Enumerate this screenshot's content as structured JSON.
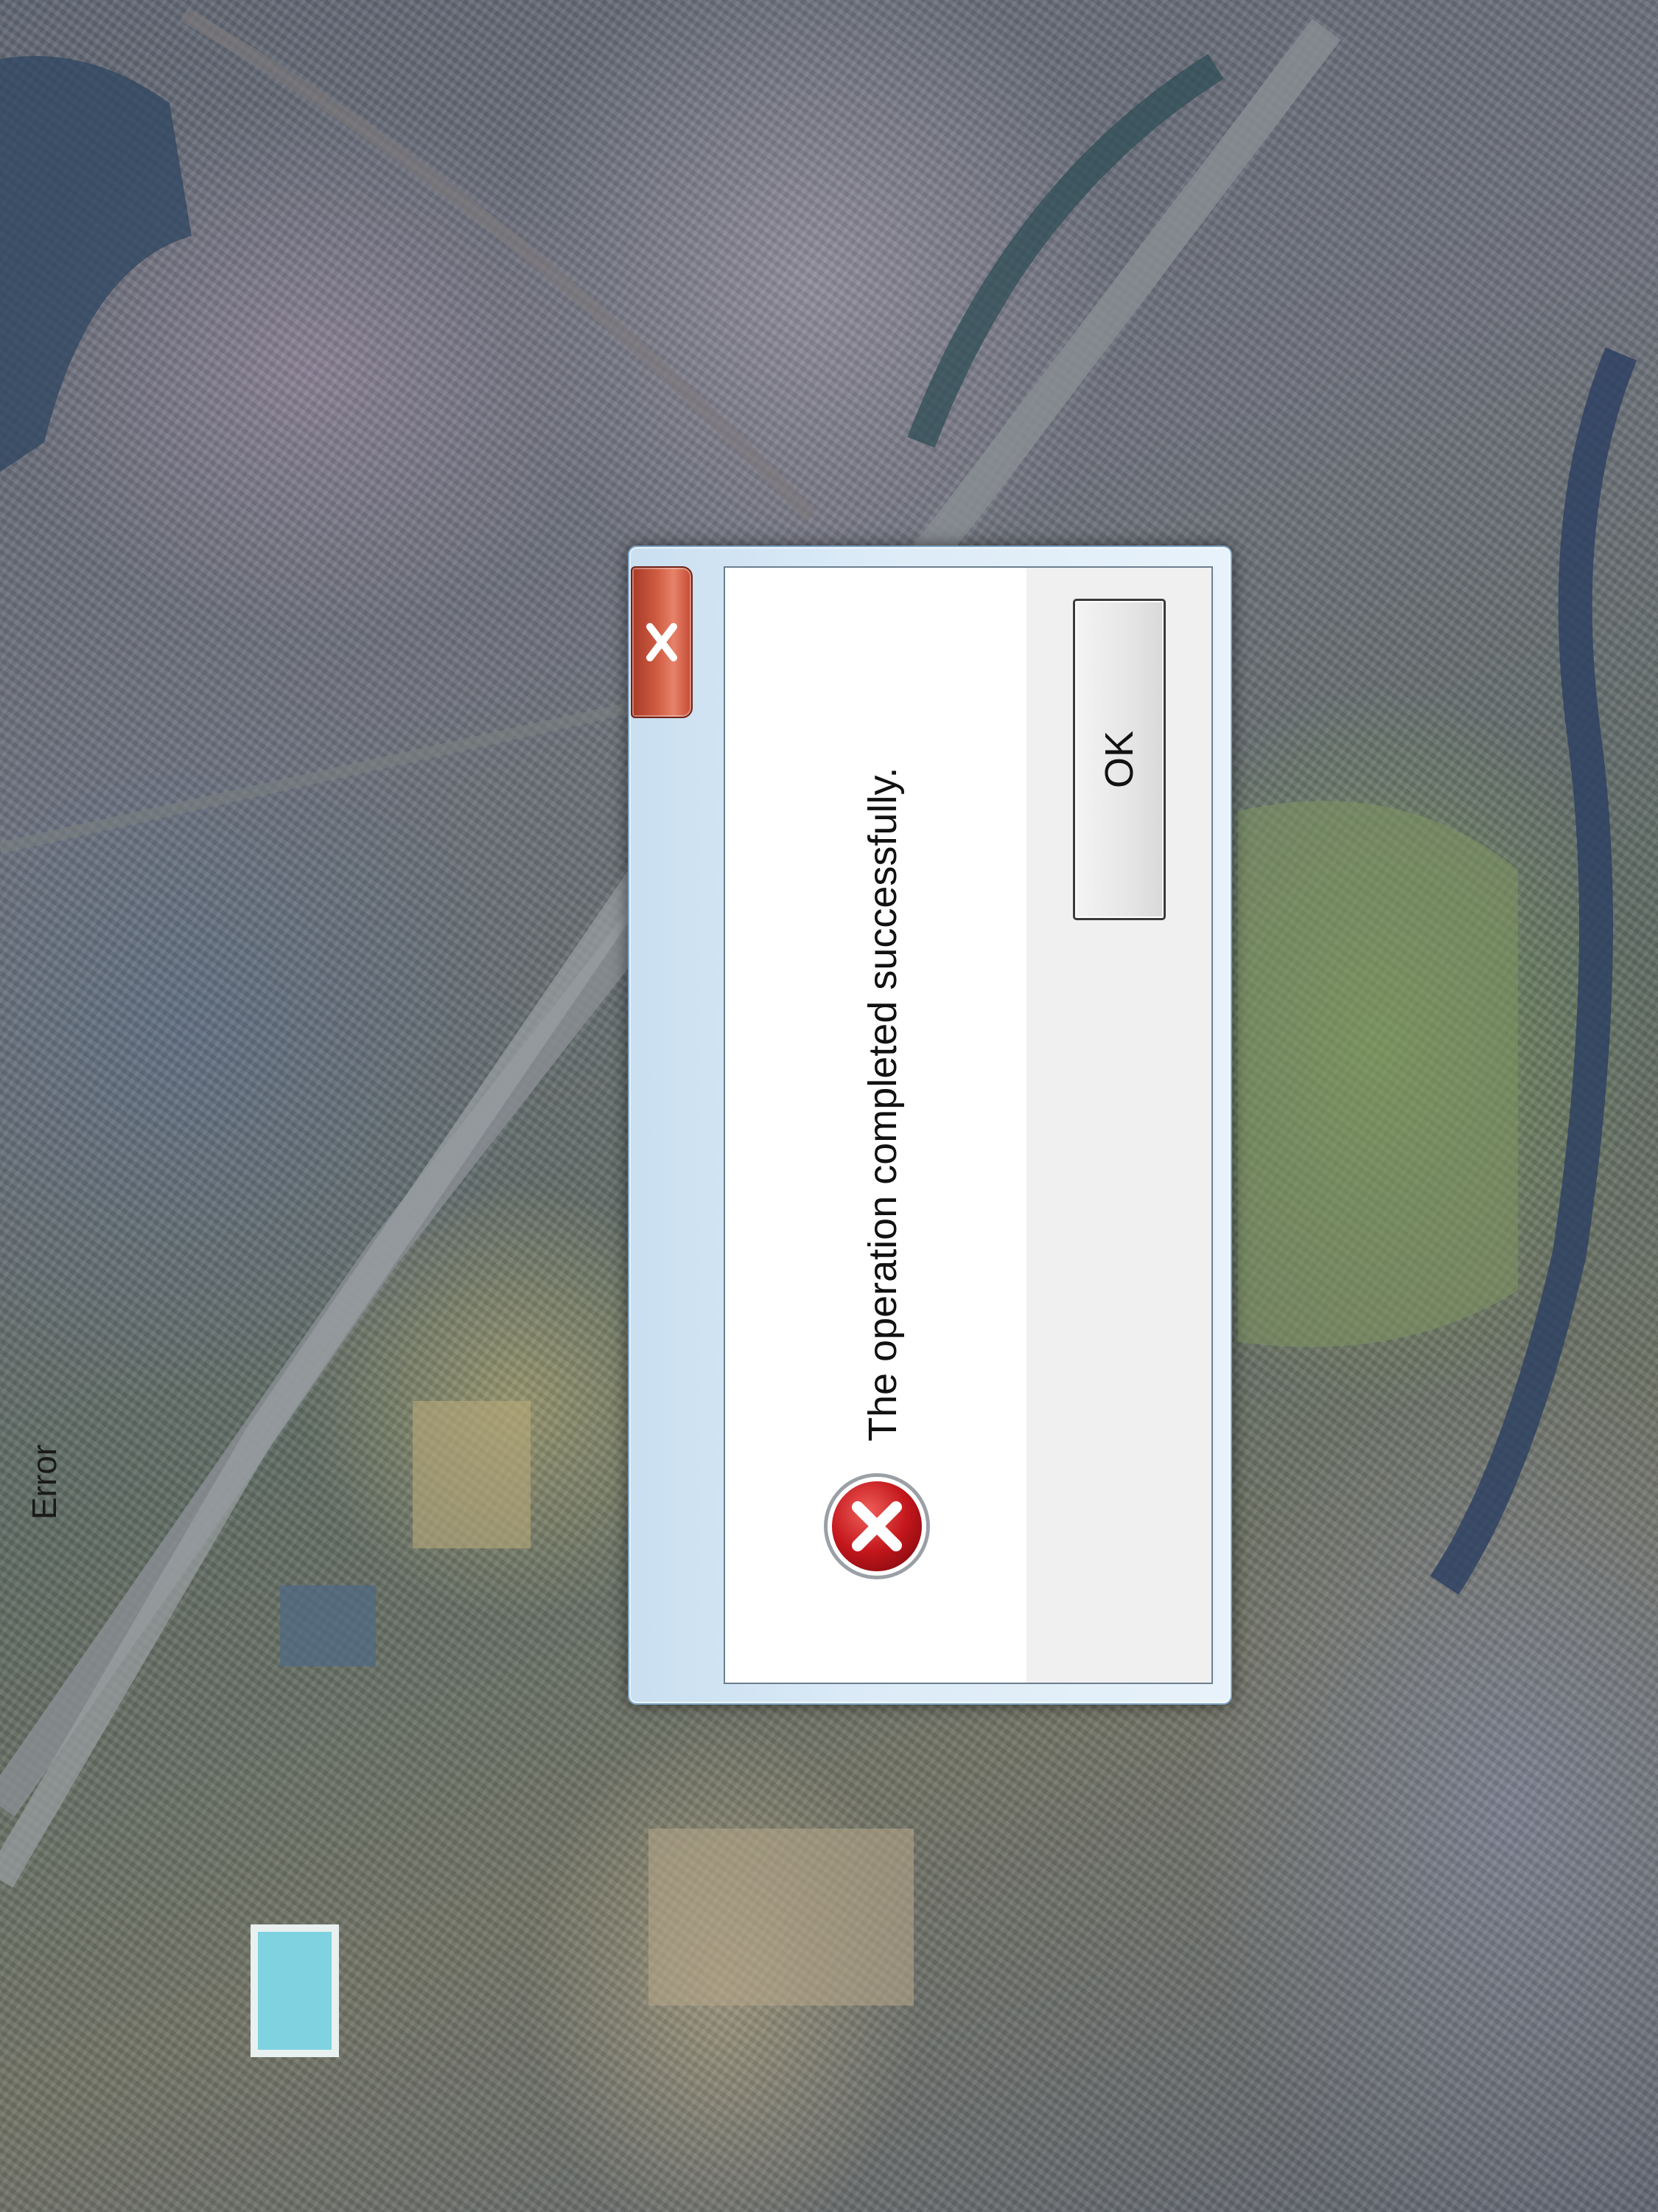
{
  "dialog": {
    "title": "Error",
    "message": "The operation completed successfully.",
    "ok_label": "OK"
  },
  "icons": {
    "close": "close-icon",
    "error": "error-icon"
  },
  "colors": {
    "close_button": "#d25f45",
    "error_icon": "#c4161c",
    "frame": "#c9dff0"
  }
}
